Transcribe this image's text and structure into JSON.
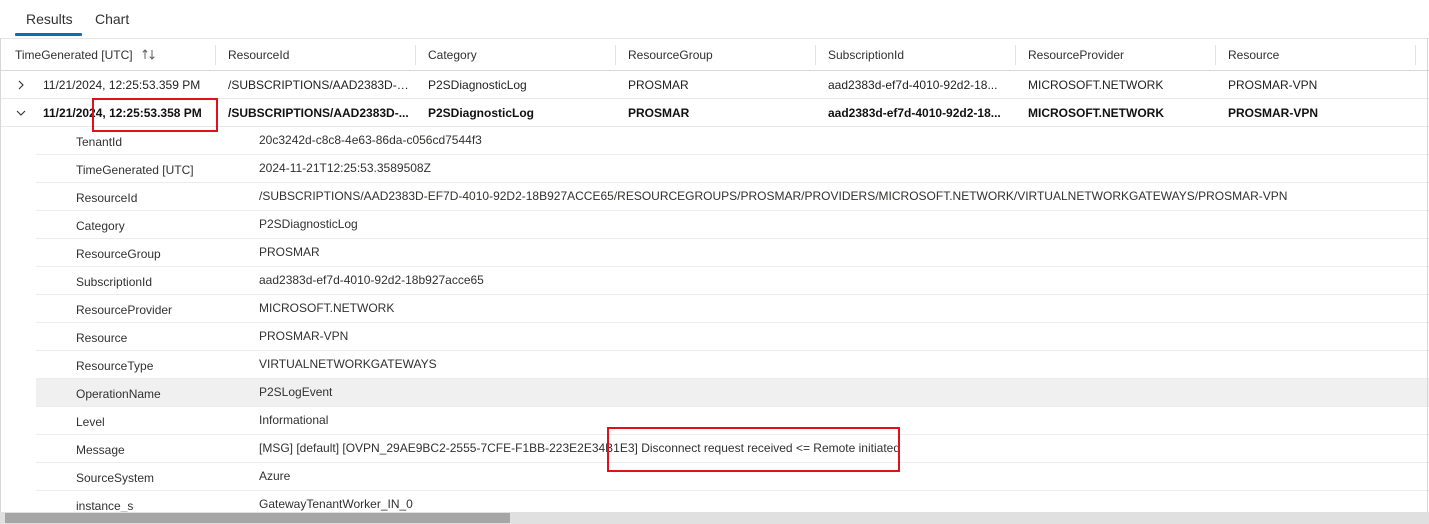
{
  "tabs": [
    {
      "label": "Results",
      "active": true
    },
    {
      "label": "Chart",
      "active": false
    }
  ],
  "columns": [
    "TimeGenerated [UTC]",
    "ResourceId",
    "Category",
    "ResourceGroup",
    "SubscriptionId",
    "ResourceProvider",
    "Resource"
  ],
  "rows": [
    {
      "expanded": false,
      "time": "11/21/2024, 12:25:53.359 PM",
      "resource_id": "/SUBSCRIPTIONS/AAD2383D-E...",
      "category": "P2SDiagnosticLog",
      "resource_group": "PROSMAR",
      "subscription_id": "aad2383d-ef7d-4010-92d2-18...",
      "resource_provider": "MICROSOFT.NETWORK",
      "resource": "PROSMAR-VPN"
    },
    {
      "expanded": true,
      "time": "11/21/2024, 12:25:53.358 PM",
      "resource_id": "/SUBSCRIPTIONS/AAD2383D-...",
      "category": "P2SDiagnosticLog",
      "resource_group": "PROSMAR",
      "subscription_id": "aad2383d-ef7d-4010-92d2-18...",
      "resource_provider": "MICROSOFT.NETWORK",
      "resource": "PROSMAR-VPN"
    }
  ],
  "details": [
    {
      "key": "TenantId",
      "value": "20c3242d-c8c8-4e63-86da-c056cd7544f3"
    },
    {
      "key": "TimeGenerated [UTC]",
      "value": "2024-11-21T12:25:53.3589508Z"
    },
    {
      "key": "ResourceId",
      "value": "/SUBSCRIPTIONS/AAD2383D-EF7D-4010-92D2-18B927ACCE65/RESOURCEGROUPS/PROSMAR/PROVIDERS/MICROSOFT.NETWORK/VIRTUALNETWORKGATEWAYS/PROSMAR-VPN"
    },
    {
      "key": "Category",
      "value": "P2SDiagnosticLog"
    },
    {
      "key": "ResourceGroup",
      "value": "PROSMAR"
    },
    {
      "key": "SubscriptionId",
      "value": "aad2383d-ef7d-4010-92d2-18b927acce65"
    },
    {
      "key": "ResourceProvider",
      "value": "MICROSOFT.NETWORK"
    },
    {
      "key": "Resource",
      "value": "PROSMAR-VPN"
    },
    {
      "key": "ResourceType",
      "value": "VIRTUALNETWORKGATEWAYS"
    },
    {
      "key": "OperationName",
      "value": "P2SLogEvent",
      "highlighted": true
    },
    {
      "key": "Level",
      "value": "Informational"
    },
    {
      "key": "Message",
      "value": "[MSG] [default] [OVPN_29AE9BC2-2555-7CFE-F1BB-223E2E34B1E3] Disconnect request received <= Remote initiated"
    },
    {
      "key": "SourceSystem",
      "value": "Azure"
    },
    {
      "key": "instance_s",
      "value": "GatewayTenantWorker_IN_0"
    }
  ],
  "icons": {
    "sort": "sort-up-down-icon",
    "collapsed": "chevron-right-icon",
    "expanded": "chevron-down-icon"
  },
  "colors": {
    "accent": "#0f6cbd",
    "annotation": "#e0111b",
    "highlight_row": "#f0f0f0"
  },
  "scroll": {
    "horizontal_thumb_fraction": 0.35
  }
}
